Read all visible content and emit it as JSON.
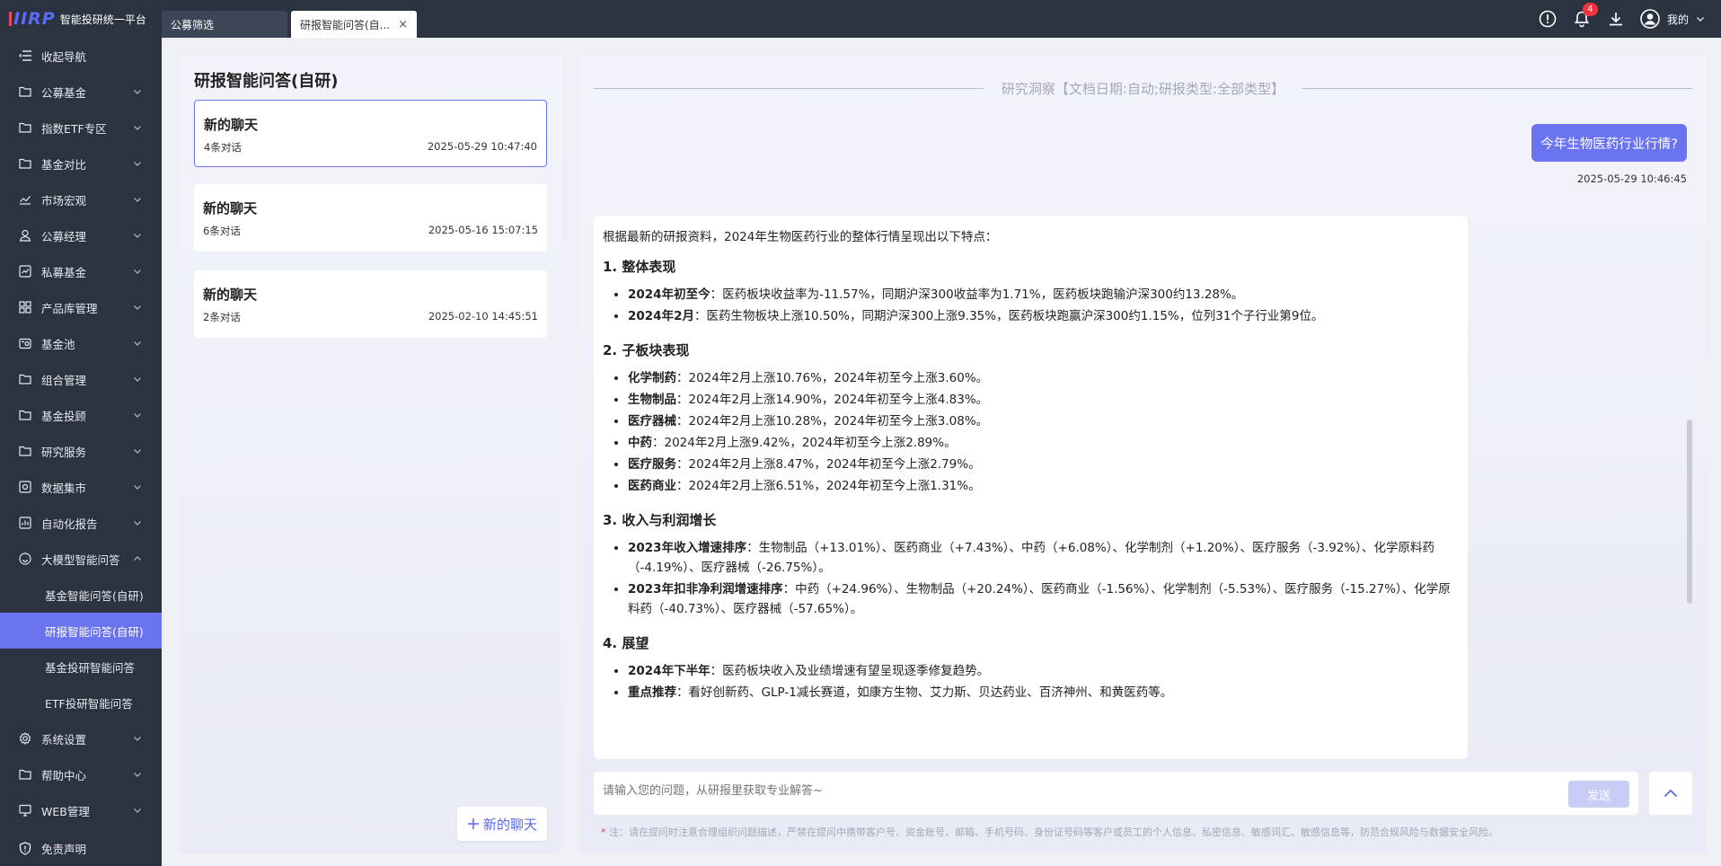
{
  "brand": {
    "logo": "IIRP",
    "title": "智能投研统一平台"
  },
  "tabs": [
    {
      "label": "公募筛选"
    },
    {
      "label": "研报智能问答(自...",
      "close": "×"
    }
  ],
  "topbar": {
    "notification_count": "4",
    "user_label": "我的"
  },
  "sidebar": {
    "collapse_label": "收起导航",
    "items": [
      {
        "label": "公募基金",
        "icon": "folder-icon"
      },
      {
        "label": "指数ETF专区",
        "icon": "folder-icon"
      },
      {
        "label": "基金对比",
        "icon": "folder-icon"
      },
      {
        "label": "市场宏观",
        "icon": "chart-line-icon"
      },
      {
        "label": "公募经理",
        "icon": "user-icon"
      },
      {
        "label": "私募基金",
        "icon": "chart-box-icon"
      },
      {
        "label": "产品库管理",
        "icon": "grid-icon"
      },
      {
        "label": "基金池",
        "icon": "pool-icon"
      },
      {
        "label": "组合管理",
        "icon": "folder-icon"
      },
      {
        "label": "基金投顾",
        "icon": "folder-icon"
      },
      {
        "label": "研究服务",
        "icon": "folder-icon"
      },
      {
        "label": "数据集市",
        "icon": "data-icon"
      },
      {
        "label": "自动化报告",
        "icon": "report-icon"
      },
      {
        "label": "大模型智能问答",
        "icon": "smile-icon"
      }
    ],
    "sub_items": [
      {
        "label": "基金智能问答(自研)"
      },
      {
        "label": "研报智能问答(自研)"
      },
      {
        "label": "基金投研智能问答"
      },
      {
        "label": "ETF投研智能问答"
      }
    ],
    "items_after": [
      {
        "label": "系统设置",
        "icon": "gear-icon"
      },
      {
        "label": "帮助中心",
        "icon": "folder-icon"
      },
      {
        "label": "WEB管理",
        "icon": "monitor-icon"
      }
    ],
    "bottom_label": "免责声明"
  },
  "left_panel": {
    "title": "研报智能问答(自研)",
    "chats": [
      {
        "title": "新的聊天",
        "count": "4条对话",
        "time": "2025-05-29 10:47:40"
      },
      {
        "title": "新的聊天",
        "count": "6条对话",
        "time": "2025-05-16 15:07:15"
      },
      {
        "title": "新的聊天",
        "count": "2条对话",
        "time": "2025-02-10 14:45:51"
      }
    ],
    "new_chat_label": "新的聊天"
  },
  "conversation": {
    "header": "研究洞察【文档日期:自动;研报类型:全部类型】",
    "question": "今年生物医药行业行情?",
    "question_time": "2025-05-29 10:46:45",
    "answer": {
      "intro": "根据最新的研报资料，2024年生物医药行业的整体行情呈现出以下特点：",
      "sections": [
        {
          "heading": "1. 整体表现",
          "items": [
            {
              "label": "2024年初至今",
              "text": "：医药板块收益率为-11.57%，同期沪深300收益率为1.71%，医药板块跑输沪深300约13.28%。"
            },
            {
              "label": "2024年2月",
              "text": "：医药生物板块上涨10.50%，同期沪深300上涨9.35%，医药板块跑赢沪深300约1.15%，位列31个子行业第9位。"
            }
          ]
        },
        {
          "heading": "2. 子板块表现",
          "items": [
            {
              "label": "化学制药",
              "text": "：2024年2月上涨10.76%，2024年初至今上涨3.60%。"
            },
            {
              "label": "生物制品",
              "text": "：2024年2月上涨14.90%，2024年初至今上涨4.83%。"
            },
            {
              "label": "医疗器械",
              "text": "：2024年2月上涨10.28%，2024年初至今上涨3.08%。"
            },
            {
              "label": "中药",
              "text": "：2024年2月上涨9.42%，2024年初至今上涨2.89%。"
            },
            {
              "label": "医疗服务",
              "text": "：2024年2月上涨8.47%，2024年初至今上涨2.79%。"
            },
            {
              "label": "医药商业",
              "text": "：2024年2月上涨6.51%，2024年初至今上涨1.31%。"
            }
          ]
        },
        {
          "heading": "3. 收入与利润增长",
          "items": [
            {
              "label": "2023年收入增速排序",
              "text": "：生物制品（+13.01%）、医药商业（+7.43%）、中药（+6.08%）、化学制剂（+1.20%）、医疗服务（-3.92%）、化学原料药（-4.19%）、医疗器械（-26.75%）。"
            },
            {
              "label": "2023年扣非净利润增速排序",
              "text": "：中药（+24.96%）、生物制品（+20.24%）、医药商业（-1.56%）、化学制剂（-5.53%）、医疗服务（-15.27%）、化学原料药（-40.73%）、医疗器械（-57.65%）。"
            }
          ]
        },
        {
          "heading": "4. 展望",
          "items": [
            {
              "label": "2024年下半年",
              "text": "：医药板块收入及业绩增速有望呈现逐季修复趋势。"
            },
            {
              "label": "重点推荐",
              "text": "：看好创新药、GLP-1减长赛道，如康方生物、艾力斯、贝达药业、百济神州、和黄医药等。"
            }
          ]
        }
      ]
    },
    "input_placeholder": "请输入您的问题，从研报里获取专业解答~",
    "send_label": "发送",
    "disclaimer_star": "*",
    "disclaimer": "注：请在提问时注意合理组织问题描述，严禁在提问中携带客户号、资金账号、邮箱、手机号码、身份证号码等客户或员工的个人信息、私密信息、敏感词汇、敏感信息等，防范合规风险与数据安全风险。"
  },
  "colors": {
    "accent": "#6a74f0",
    "sidebar_bg": "#2b3240",
    "badge": "#f0353f"
  }
}
